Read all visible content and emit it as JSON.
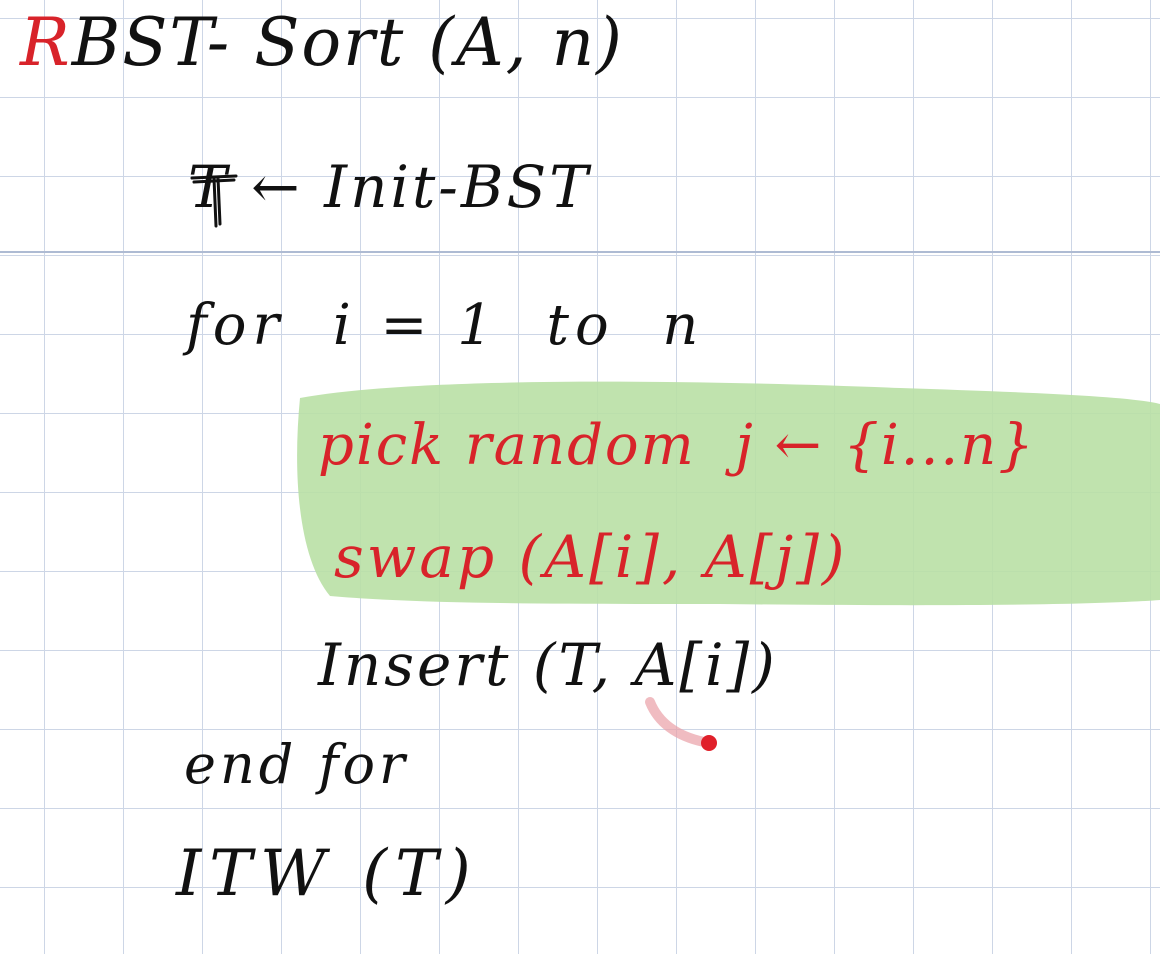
{
  "notes": {
    "title": {
      "initial": "R",
      "rest": "BST- Sort (A, n)"
    },
    "init_line": "T ← Init-BST",
    "for_line": "for  i = 1  to  n",
    "highlighted": {
      "pick_line": "pick random  j ← {i...n}",
      "swap_line": "swap (A[i], A[j])"
    },
    "insert_line": "Insert (T, A[i])",
    "endfor_line": "end for",
    "itw_line": "ITW (T)"
  },
  "colors": {
    "ink_black": "#111111",
    "ink_red": "#d8232a",
    "highlight_green": "#b9e0a5",
    "grid": "#cdd6e6",
    "page_break": "#aebbd3",
    "pen_dot": "#e0202a"
  }
}
